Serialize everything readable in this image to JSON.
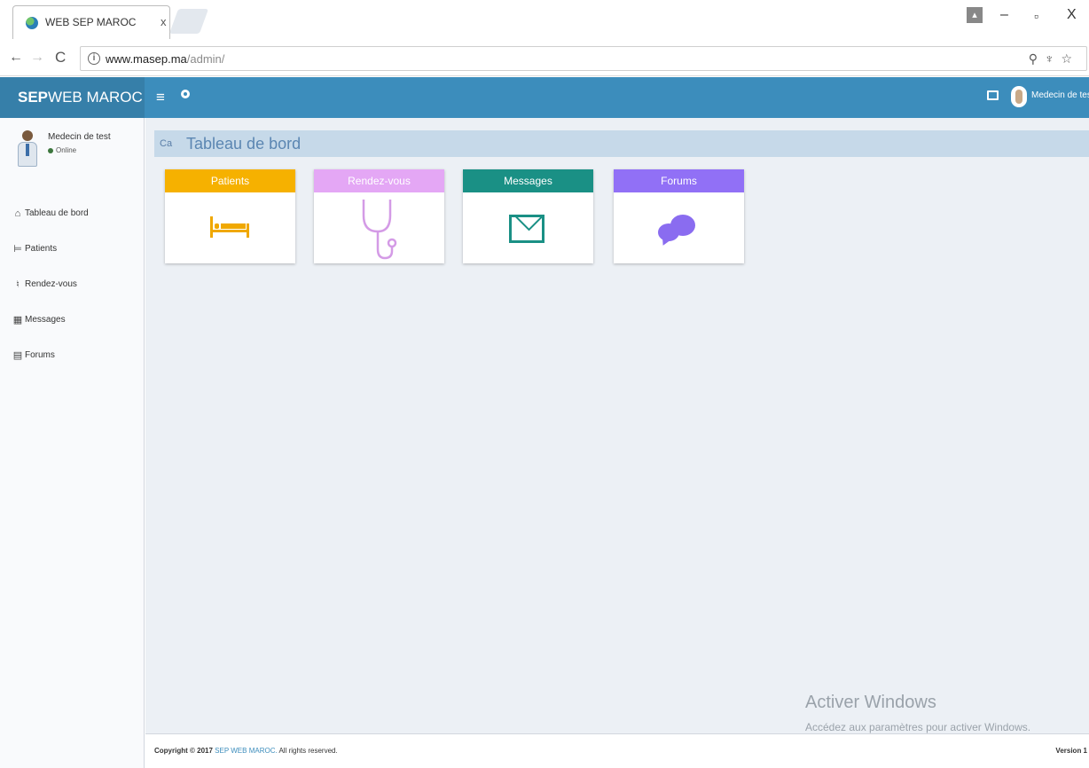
{
  "browser": {
    "tab_title": "WEB SEP MAROC",
    "tab_close": "x",
    "url_host": "www.masep.ma",
    "url_path": "/admin/",
    "minimize": "–",
    "restore": "▫",
    "close": "X"
  },
  "header": {
    "logo_bold": "SEP",
    "logo_rest": "WEB MAROC",
    "menu_glyph": "≡",
    "user_name": "Medecin de test"
  },
  "sidebar": {
    "user": {
      "name": "Medecin de test",
      "status": "Online"
    },
    "items": [
      {
        "label": "Tableau de bord",
        "icon": "dashboard-icon",
        "glyph": "⌂"
      },
      {
        "label": "Patients",
        "icon": "bed-icon",
        "glyph": "⊨"
      },
      {
        "label": "Rendez-vous",
        "icon": "stethoscope-icon",
        "glyph": "♮"
      },
      {
        "label": "Messages",
        "icon": "envelope-icon",
        "glyph": "▦"
      },
      {
        "label": "Forums",
        "icon": "forum-icon",
        "glyph": "▤"
      }
    ]
  },
  "content": {
    "breadcrumb_icon": "Ca",
    "page_title": "Tableau de bord",
    "cards": [
      {
        "label": "Patients",
        "color": "#f6b100",
        "icon": "bed-icon"
      },
      {
        "label": "Rendez-vous",
        "color": "#e4a7f5",
        "icon": "stethoscope-icon"
      },
      {
        "label": "Messages",
        "color": "#1a9085",
        "icon": "envelope-icon"
      },
      {
        "label": "Forums",
        "color": "#9170f6",
        "icon": "chat-icon"
      }
    ]
  },
  "watermark": {
    "title": "Activer Windows",
    "subtitle": "Accédez aux paramètres pour activer Windows."
  },
  "footer": {
    "copyright_prefix": "Copyright © 2017",
    "brand": "SEP WEB MAROC.",
    "rights": "All rights reserved.",
    "version": "Version 1"
  }
}
